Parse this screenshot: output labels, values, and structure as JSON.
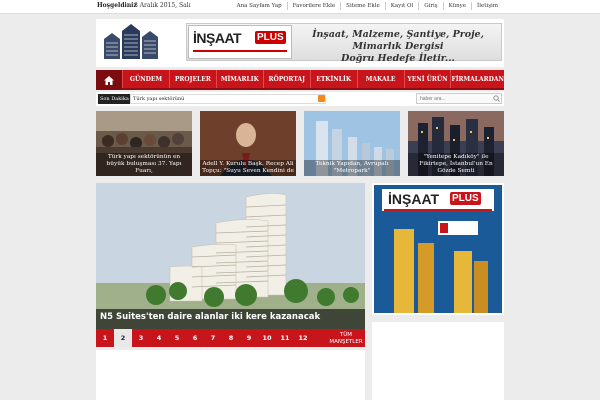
{
  "topbar": {
    "welcome": "Hoşgeldiniz",
    "date": "8 Aralık 2015, Salı",
    "links": [
      "Ana Sayfam Yap",
      "Favorilere Ekle",
      "Siteme Ekle",
      "Kayıt Ol",
      "Giriş",
      "Künye",
      "İletişim"
    ]
  },
  "header": {
    "logo_url": "www.insaatplus.com",
    "banner_brand": "İNŞAAT",
    "banner_plus": "PLUS",
    "banner_tagline_1": "İnşaat, Malzeme, Şantiye, Proje, Mimarlık Dergisi",
    "banner_tagline_2": "Doğru Hedefe İletir..."
  },
  "nav": {
    "items": [
      "GÜNDEM",
      "PROJELER",
      "MİMARLIK",
      "RÖPORTAJ",
      "ETKİNLİK",
      "MAKALE",
      "YENİ ÜRÜN",
      "FİRMALARDAN"
    ]
  },
  "ticker": {
    "label": "Son Dakika",
    "text": "Türk yapı sektörünü"
  },
  "search": {
    "placeholder": "haber ara..."
  },
  "thumbs": [
    {
      "caption": "Türk yapı sektörünün en büyük buluşması 37. Yapı Fuarı,"
    },
    {
      "caption": "Adell Y. Kurulu Başk. Recep Ali Topçu: \"Suyu Seven Kendini de"
    },
    {
      "caption": "Teknik Yapıdan, Avrupalı \"Metropark\""
    },
    {
      "caption": "\"Yenitepe Kadıköy\" ile Fikirtepe, İstanbul'un En Gözde Semti"
    }
  ],
  "slider": {
    "title": "N5 Suites'ten daire alanlar iki kere kazanacak",
    "pages": [
      "1",
      "2",
      "3",
      "4",
      "5",
      "6",
      "7",
      "8",
      "9",
      "10",
      "11",
      "12"
    ],
    "active_page": "2",
    "all_label": "TÜM MANŞETLER"
  },
  "ad": {
    "brand": "İNŞAAT",
    "plus": "PLUS"
  },
  "colors": {
    "accent": "#c8151b",
    "accent_dark": "#7d0c10"
  }
}
